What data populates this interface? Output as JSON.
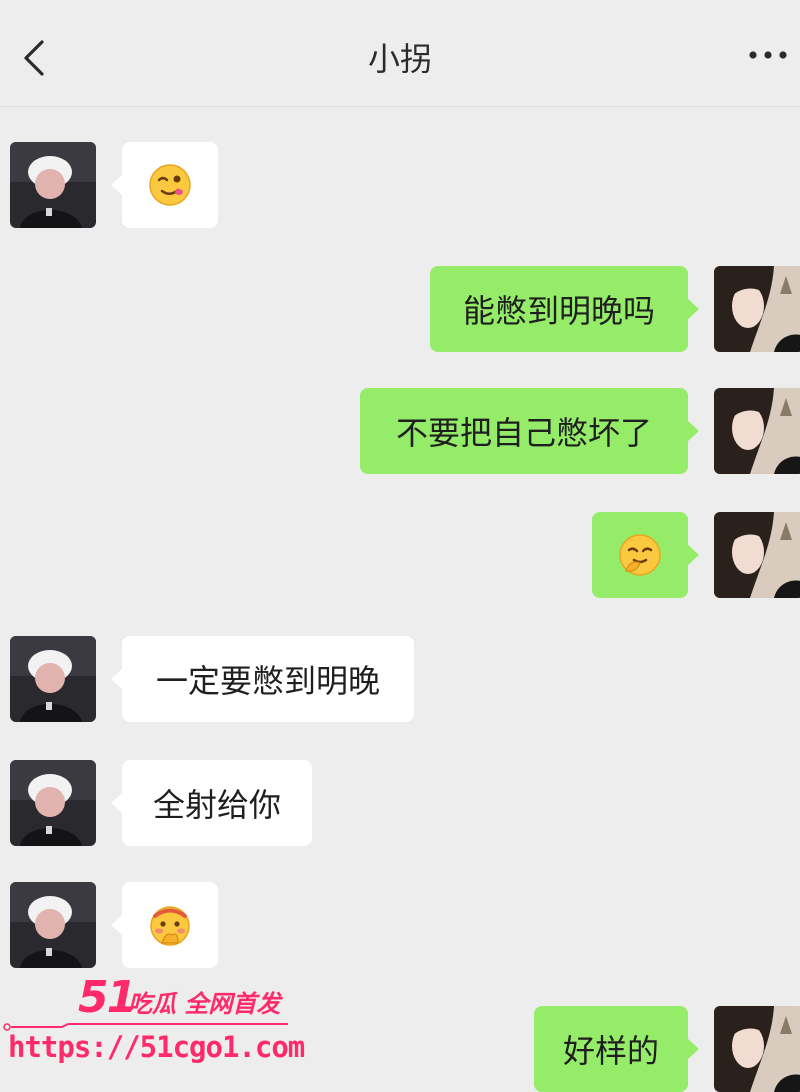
{
  "header": {
    "title": "小拐",
    "back_icon": "chevron-left-icon",
    "more_icon": "more-dots-icon"
  },
  "colors": {
    "background": "#ededed",
    "outgoing_bubble": "#95ec69",
    "incoming_bubble": "#ffffff",
    "watermark": "#ff2a6b"
  },
  "messages": [
    {
      "side": "left",
      "type": "emoji",
      "emoji": "winking-face-emoji"
    },
    {
      "side": "right",
      "type": "text",
      "text": "能憋到明晚吗"
    },
    {
      "side": "right",
      "type": "text",
      "text": "不要把自己憋坏了"
    },
    {
      "side": "right",
      "type": "emoji",
      "emoji": "smirking-face-emoji"
    },
    {
      "side": "left",
      "type": "text",
      "text": "一定要憋到明晚"
    },
    {
      "side": "left",
      "type": "text",
      "text": "全射给你"
    },
    {
      "side": "left",
      "type": "emoji",
      "emoji": "embarrassed-face-emoji"
    },
    {
      "side": "right",
      "type": "text",
      "text": "好样的"
    }
  ],
  "watermark": {
    "number": "51",
    "brand": "吃瓜 全网首发",
    "url": "https://51cgo1.com"
  }
}
